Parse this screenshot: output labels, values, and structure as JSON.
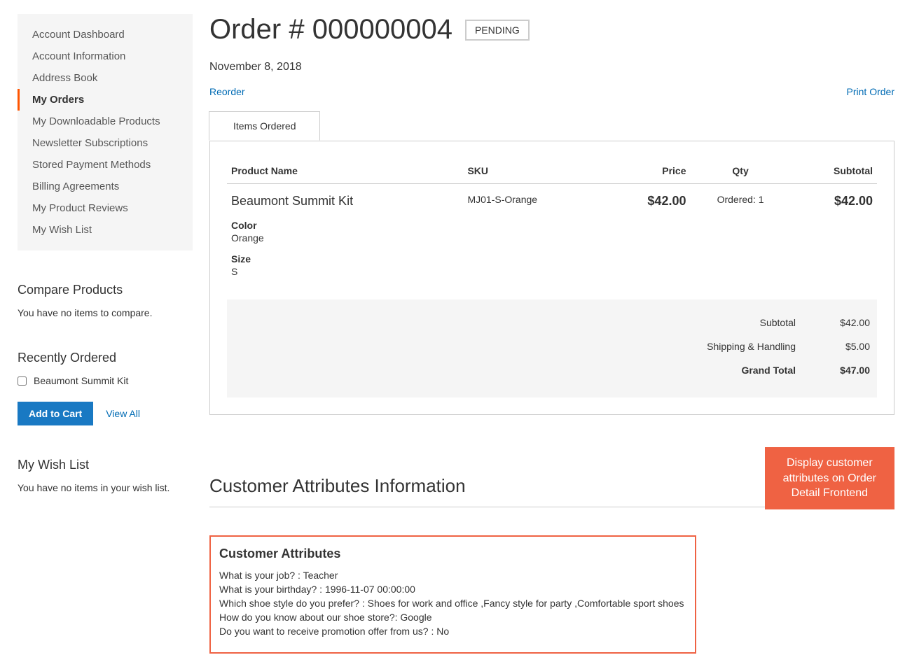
{
  "sidebar": {
    "nav": [
      {
        "label": "Account Dashboard",
        "active": false
      },
      {
        "label": "Account Information",
        "active": false
      },
      {
        "label": "Address Book",
        "active": false
      },
      {
        "label": "My Orders",
        "active": true
      },
      {
        "label": "My Downloadable Products",
        "active": false
      },
      {
        "label": "Newsletter Subscriptions",
        "active": false
      },
      {
        "label": "Stored Payment Methods",
        "active": false
      },
      {
        "label": "Billing Agreements",
        "active": false
      },
      {
        "label": "My Product Reviews",
        "active": false
      },
      {
        "label": "My Wish List",
        "active": false
      }
    ],
    "compare": {
      "title": "Compare Products",
      "empty": "You have no items to compare."
    },
    "recent": {
      "title": "Recently Ordered",
      "item": "Beaumont Summit Kit",
      "add_to_cart": "Add to Cart",
      "view_all": "View All"
    },
    "wishlist": {
      "title": "My Wish List",
      "empty": "You have no items in your wish list."
    }
  },
  "order": {
    "title": "Order # 000000004",
    "status": "Pending",
    "date": "November 8, 2018",
    "reorder": "Reorder",
    "print": "Print Order",
    "tab_label": "Items Ordered",
    "columns": {
      "name": "Product Name",
      "sku": "SKU",
      "price": "Price",
      "qty": "Qty",
      "subtotal": "Subtotal"
    },
    "item": {
      "name": "Beaumont Summit Kit",
      "sku": "MJ01-S-Orange",
      "price": "$42.00",
      "qty_label": "Ordered:",
      "qty": "1",
      "subtotal": "$42.00",
      "color_label": "Color",
      "color": "Orange",
      "size_label": "Size",
      "size": "S"
    },
    "totals": {
      "subtotal_label": "Subtotal",
      "subtotal": "$42.00",
      "shipping_label": "Shipping & Handling",
      "shipping": "$5.00",
      "grand_label": "Grand Total",
      "grand": "$47.00"
    }
  },
  "cai": {
    "title": "Customer Attributes Information",
    "callout_l1": "Display customer",
    "callout_l2": "attributes on Order",
    "callout_l3": "Detail Frontend",
    "box_title": "Customer Attributes",
    "lines": [
      "What is your job? : Teacher",
      "What is your birthday? : 1996-11-07 00:00:00",
      "Which shoe style do you prefer? : Shoes for work and office ,Fancy style for party ,Comfortable sport shoes",
      "How do you know about our shoe store?: Google",
      "Do you want to receive promotion offer from us? : No"
    ]
  }
}
